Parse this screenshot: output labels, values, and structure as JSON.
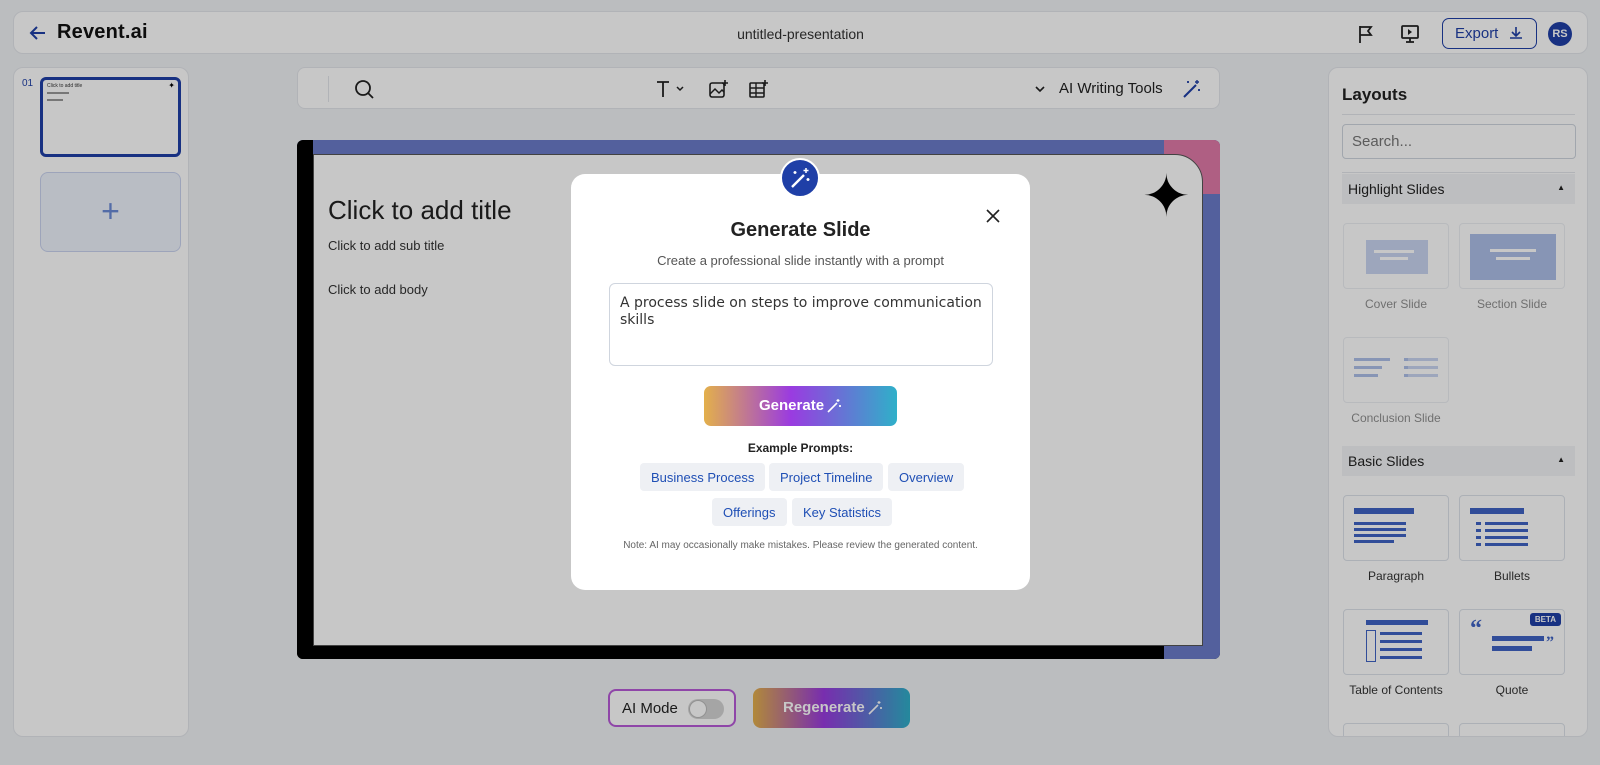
{
  "header": {
    "brand": "Revent.ai",
    "doc_title": "untitled-presentation",
    "export_label": "Export",
    "avatar_initials": "RS"
  },
  "left_panel": {
    "slide_number": "01",
    "thumb_title": "Click to add title"
  },
  "toolbar": {
    "ai_writing_tools": "AI Writing Tools"
  },
  "canvas": {
    "title": "Click to add title",
    "subtitle": "Click to add sub title",
    "body": "Click to add body"
  },
  "bottom": {
    "ai_mode": "AI Mode",
    "ai_mode_on": false,
    "regenerate": "Regenerate"
  },
  "right_panel": {
    "title": "Layouts",
    "search_placeholder": "Search...",
    "sections": [
      {
        "name": "Highlight Slides",
        "items": [
          "Cover Slide",
          "Section Slide",
          "Conclusion Slide"
        ]
      },
      {
        "name": "Basic Slides",
        "items": [
          "Paragraph",
          "Bullets",
          "Table of Contents",
          "Quote"
        ]
      }
    ],
    "beta_badge": "BETA"
  },
  "modal": {
    "title": "Generate Slide",
    "description": "Create a professional slide instantly with a prompt",
    "prompt_value": "A process slide on steps to improve communication skills",
    "generate_label": "Generate",
    "examples_label": "Example Prompts:",
    "examples": [
      "Business Process",
      "Project Timeline",
      "Overview",
      "Offerings",
      "Key Statistics"
    ],
    "note": "Note: AI may occasionally make mistakes. Please review the generated content."
  },
  "colors": {
    "accent": "#1f3fa7",
    "canvas_band": "#6b7cc9",
    "canvas_corner": "#e07aa8"
  }
}
